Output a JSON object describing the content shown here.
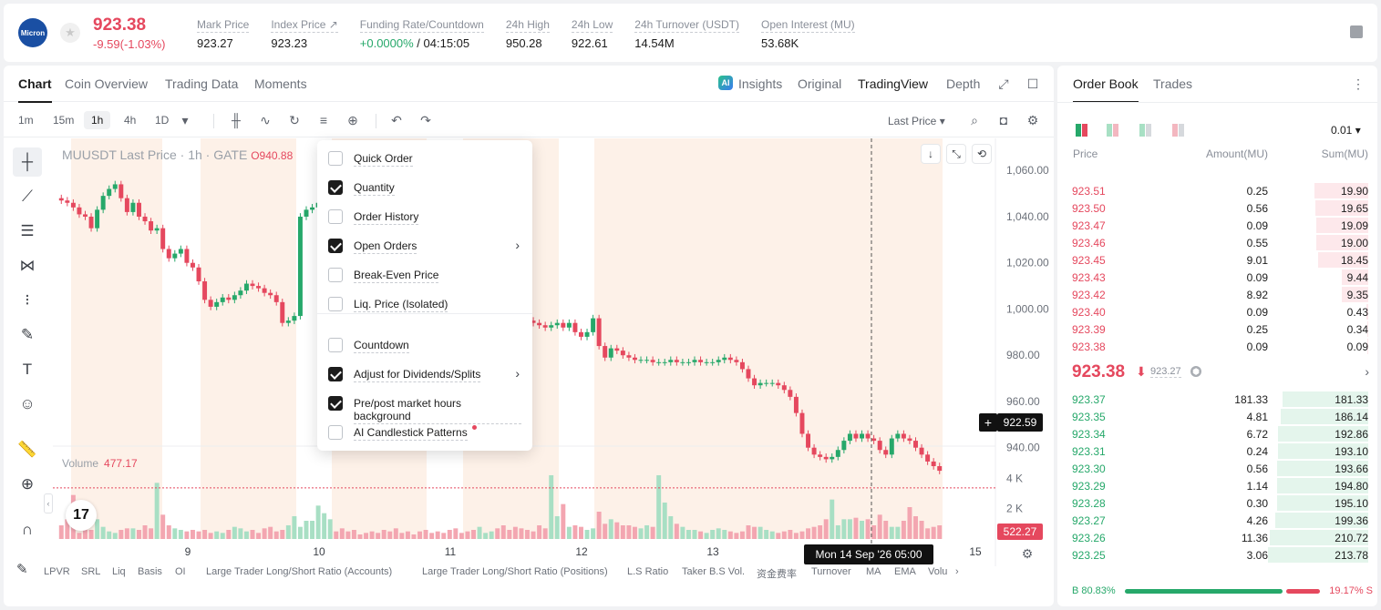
{
  "header": {
    "logo_text": "Micron",
    "price": "923.38",
    "change": "-9.59(-1.03%)",
    "stats": [
      {
        "label": "Mark Price",
        "value": "923.27"
      },
      {
        "label": "Index Price ↗",
        "value": "923.23"
      },
      {
        "label": "Funding Rate/Countdown",
        "value_green": "+0.0000%",
        "value": " / 04:15:05"
      },
      {
        "label": "24h High",
        "value": "950.28"
      },
      {
        "label": "24h Low",
        "value": "922.61"
      },
      {
        "label": "24h Turnover (USDT)",
        "value": "14.54M"
      },
      {
        "label": "Open Interest (MU)",
        "value": "53.68K"
      }
    ]
  },
  "chart_tabs": [
    "Chart",
    "Coin Overview",
    "Trading Data",
    "Moments"
  ],
  "chart_views": {
    "insights": "Insights",
    "original": "Original",
    "tradingview": "TradingView",
    "depth": "Depth",
    "ai_badge": "AI"
  },
  "toolbar": {
    "timeframes": [
      "1m",
      "15m",
      "1h",
      "4h",
      "1D"
    ],
    "price_source": "Last Price"
  },
  "legend": {
    "symbol": "MUUSDT Last Price · 1h · GATE",
    "open": "O940.88"
  },
  "volume_legend": {
    "label": "Volume",
    "value": "477.17"
  },
  "price_tag": "922.59",
  "volume_tag": "522.27",
  "crosshair_date": "Mon 14 Sep '26   05:00",
  "tv_logo": "17",
  "indicators": [
    "LPVR",
    "SRL",
    "Liq",
    "Basis",
    "OI",
    "Large Trader Long/Short Ratio (Accounts)",
    "Large Trader Long/Short Ratio (Positions)",
    "L.S Ratio",
    "Taker B.S Vol.",
    "资金费率",
    "Turnover",
    "MA",
    "EMA",
    "Volu"
  ],
  "menu": {
    "items": [
      {
        "label": "Quick Order",
        "checked": false
      },
      {
        "label": "Quantity",
        "checked": true
      },
      {
        "label": "Order History",
        "checked": false
      },
      {
        "label": "Open Orders",
        "checked": true,
        "submenu": true
      },
      {
        "label": "Break-Even Price",
        "checked": false
      },
      {
        "label": "Liq. Price (Isolated)",
        "checked": false
      },
      {
        "label": "Countdown",
        "checked": false
      },
      {
        "label": "Adjust for Dividends/Splits",
        "checked": true,
        "submenu": true
      },
      {
        "label": "Pre/post market hours background",
        "checked": true
      },
      {
        "label": "AI Candlestick Patterns",
        "checked": false,
        "dot": true
      }
    ]
  },
  "chart_data": {
    "type": "candlestick",
    "y_axis_ticks": [
      "1,060.00",
      "1,040.00",
      "1,020.00",
      "1,000.00",
      "980.00",
      "960.00",
      "940.00"
    ],
    "ylim": [
      932,
      1066
    ],
    "volume_ticks": [
      "4 K",
      "2 K"
    ],
    "x_ticks": [
      "9",
      "10",
      "11",
      "12",
      "13",
      "15"
    ],
    "last_price": 922.59,
    "closes": [
      1047,
      1046,
      1044,
      1041,
      1040,
      1035,
      1043,
      1049,
      1052,
      1054,
      1048,
      1042,
      1046,
      1040,
      1038,
      1034,
      1035,
      1026,
      1022,
      1024,
      1026,
      1020,
      1018,
      1012,
      1004,
      1001,
      1003,
      1005,
      1004,
      1006,
      1008,
      1011,
      1010,
      1009,
      1007,
      1006,
      1003,
      994,
      995,
      997,
      1040,
      1043,
      1044,
      1046,
      1048,
      1049,
      1046,
      1045,
      1043,
      1040,
      1038,
      1036,
      1033,
      1030,
      1027,
      1024,
      1021,
      1018,
      1015,
      1012,
      1010,
      1008,
      1006,
      1004,
      1003,
      1002,
      1001,
      1000,
      999,
      998,
      999,
      1000,
      1001,
      1000,
      999,
      998,
      997,
      996,
      995,
      994,
      993,
      992,
      993,
      994,
      992,
      994,
      990,
      988,
      990,
      996,
      984,
      979,
      983,
      982,
      980,
      979,
      978,
      978,
      978,
      977,
      977,
      977,
      978,
      977,
      977,
      977,
      978,
      977,
      977,
      977,
      978,
      979,
      978,
      977,
      974,
      970,
      967,
      968,
      968,
      968,
      967,
      965,
      962,
      955,
      946,
      940,
      937,
      936,
      935,
      936,
      939,
      943,
      946,
      944,
      946,
      944,
      943,
      939,
      937,
      944,
      946,
      944,
      943,
      940,
      937,
      934,
      932,
      930
    ],
    "volumes": [
      900,
      1300,
      2900,
      400,
      800,
      600,
      1300,
      800,
      500,
      400,
      600,
      700,
      700,
      600,
      900,
      700,
      3700,
      1600,
      900,
      700,
      600,
      500,
      600,
      500,
      600,
      400,
      500,
      400,
      600,
      800,
      700,
      500,
      600,
      400,
      700,
      800,
      500,
      600,
      900,
      1500,
      800,
      1200,
      1200,
      2200,
      1700,
      1300,
      500,
      700,
      500,
      600,
      300,
      400,
      500,
      400,
      600,
      500,
      700,
      400,
      500,
      300,
      500,
      600,
      400,
      500,
      400,
      600,
      700,
      400,
      500,
      600,
      800,
      400,
      500,
      700,
      900,
      600,
      800,
      700,
      600,
      500,
      900,
      700,
      4200,
      1500,
      2300,
      800,
      900,
      800,
      600,
      700,
      1800,
      1000,
      1300,
      1100,
      900,
      900,
      800,
      700,
      900,
      800,
      4200,
      2400,
      1500,
      1000,
      800,
      600,
      600,
      500,
      400,
      600,
      700,
      600,
      500,
      400,
      500,
      900,
      800,
      800,
      600,
      500,
      400,
      500,
      600,
      400,
      500,
      700,
      800,
      900,
      1300,
      2600,
      900,
      1300,
      1300,
      1400,
      1200,
      1300,
      900,
      1600,
      1200,
      800,
      800,
      1200,
      2100,
      1500,
      1200,
      700,
      800,
      900,
      700,
      800,
      900,
      800,
      700,
      600
    ]
  },
  "orderbook": {
    "tabs": [
      "Order Book",
      "Trades"
    ],
    "tick": "0.01",
    "headers": {
      "price": "Price",
      "amount": "Amount(MU)",
      "sum": "Sum(MU)"
    },
    "asks": [
      {
        "price": "923.51",
        "amount": "0.25",
        "sum": "19.90",
        "depth": 0.54
      },
      {
        "price": "923.50",
        "amount": "0.56",
        "sum": "19.65",
        "depth": 0.53
      },
      {
        "price": "923.47",
        "amount": "0.09",
        "sum": "19.09",
        "depth": 0.52
      },
      {
        "price": "923.46",
        "amount": "0.55",
        "sum": "19.00",
        "depth": 0.52
      },
      {
        "price": "923.45",
        "amount": "9.01",
        "sum": "18.45",
        "depth": 0.5
      },
      {
        "price": "923.43",
        "amount": "0.09",
        "sum": "9.44",
        "depth": 0.26
      },
      {
        "price": "923.42",
        "amount": "8.92",
        "sum": "9.35",
        "depth": 0.26
      },
      {
        "price": "923.40",
        "amount": "0.09",
        "sum": "0.43",
        "depth": 0.02
      },
      {
        "price": "923.39",
        "amount": "0.25",
        "sum": "0.34",
        "depth": 0.01
      },
      {
        "price": "923.38",
        "amount": "0.09",
        "sum": "0.09",
        "depth": 0.005
      }
    ],
    "mid": {
      "price": "923.38",
      "arrow": "⬇",
      "mark": "923.27",
      "shield": "⬢"
    },
    "bids": [
      {
        "price": "923.37",
        "amount": "181.33",
        "sum": "181.33",
        "depth": 0.85
      },
      {
        "price": "923.35",
        "amount": "4.81",
        "sum": "186.14",
        "depth": 0.87
      },
      {
        "price": "923.34",
        "amount": "6.72",
        "sum": "192.86",
        "depth": 0.9
      },
      {
        "price": "923.31",
        "amount": "0.24",
        "sum": "193.10",
        "depth": 0.9
      },
      {
        "price": "923.30",
        "amount": "0.56",
        "sum": "193.66",
        "depth": 0.91
      },
      {
        "price": "923.29",
        "amount": "1.14",
        "sum": "194.80",
        "depth": 0.91
      },
      {
        "price": "923.28",
        "amount": "0.30",
        "sum": "195.10",
        "depth": 0.91
      },
      {
        "price": "923.27",
        "amount": "4.26",
        "sum": "199.36",
        "depth": 0.93
      },
      {
        "price": "923.26",
        "amount": "11.36",
        "sum": "210.72",
        "depth": 0.98
      },
      {
        "price": "923.25",
        "amount": "3.06",
        "sum": "213.78",
        "depth": 1.0
      }
    ],
    "ratio": {
      "buy": "B 80.83%",
      "sell": "19.17% S",
      "buy_fraction": 0.8083
    }
  },
  "colors": {
    "up": "#26a86a",
    "down": "#e5485e",
    "session_bg": "#fdf1e8"
  }
}
